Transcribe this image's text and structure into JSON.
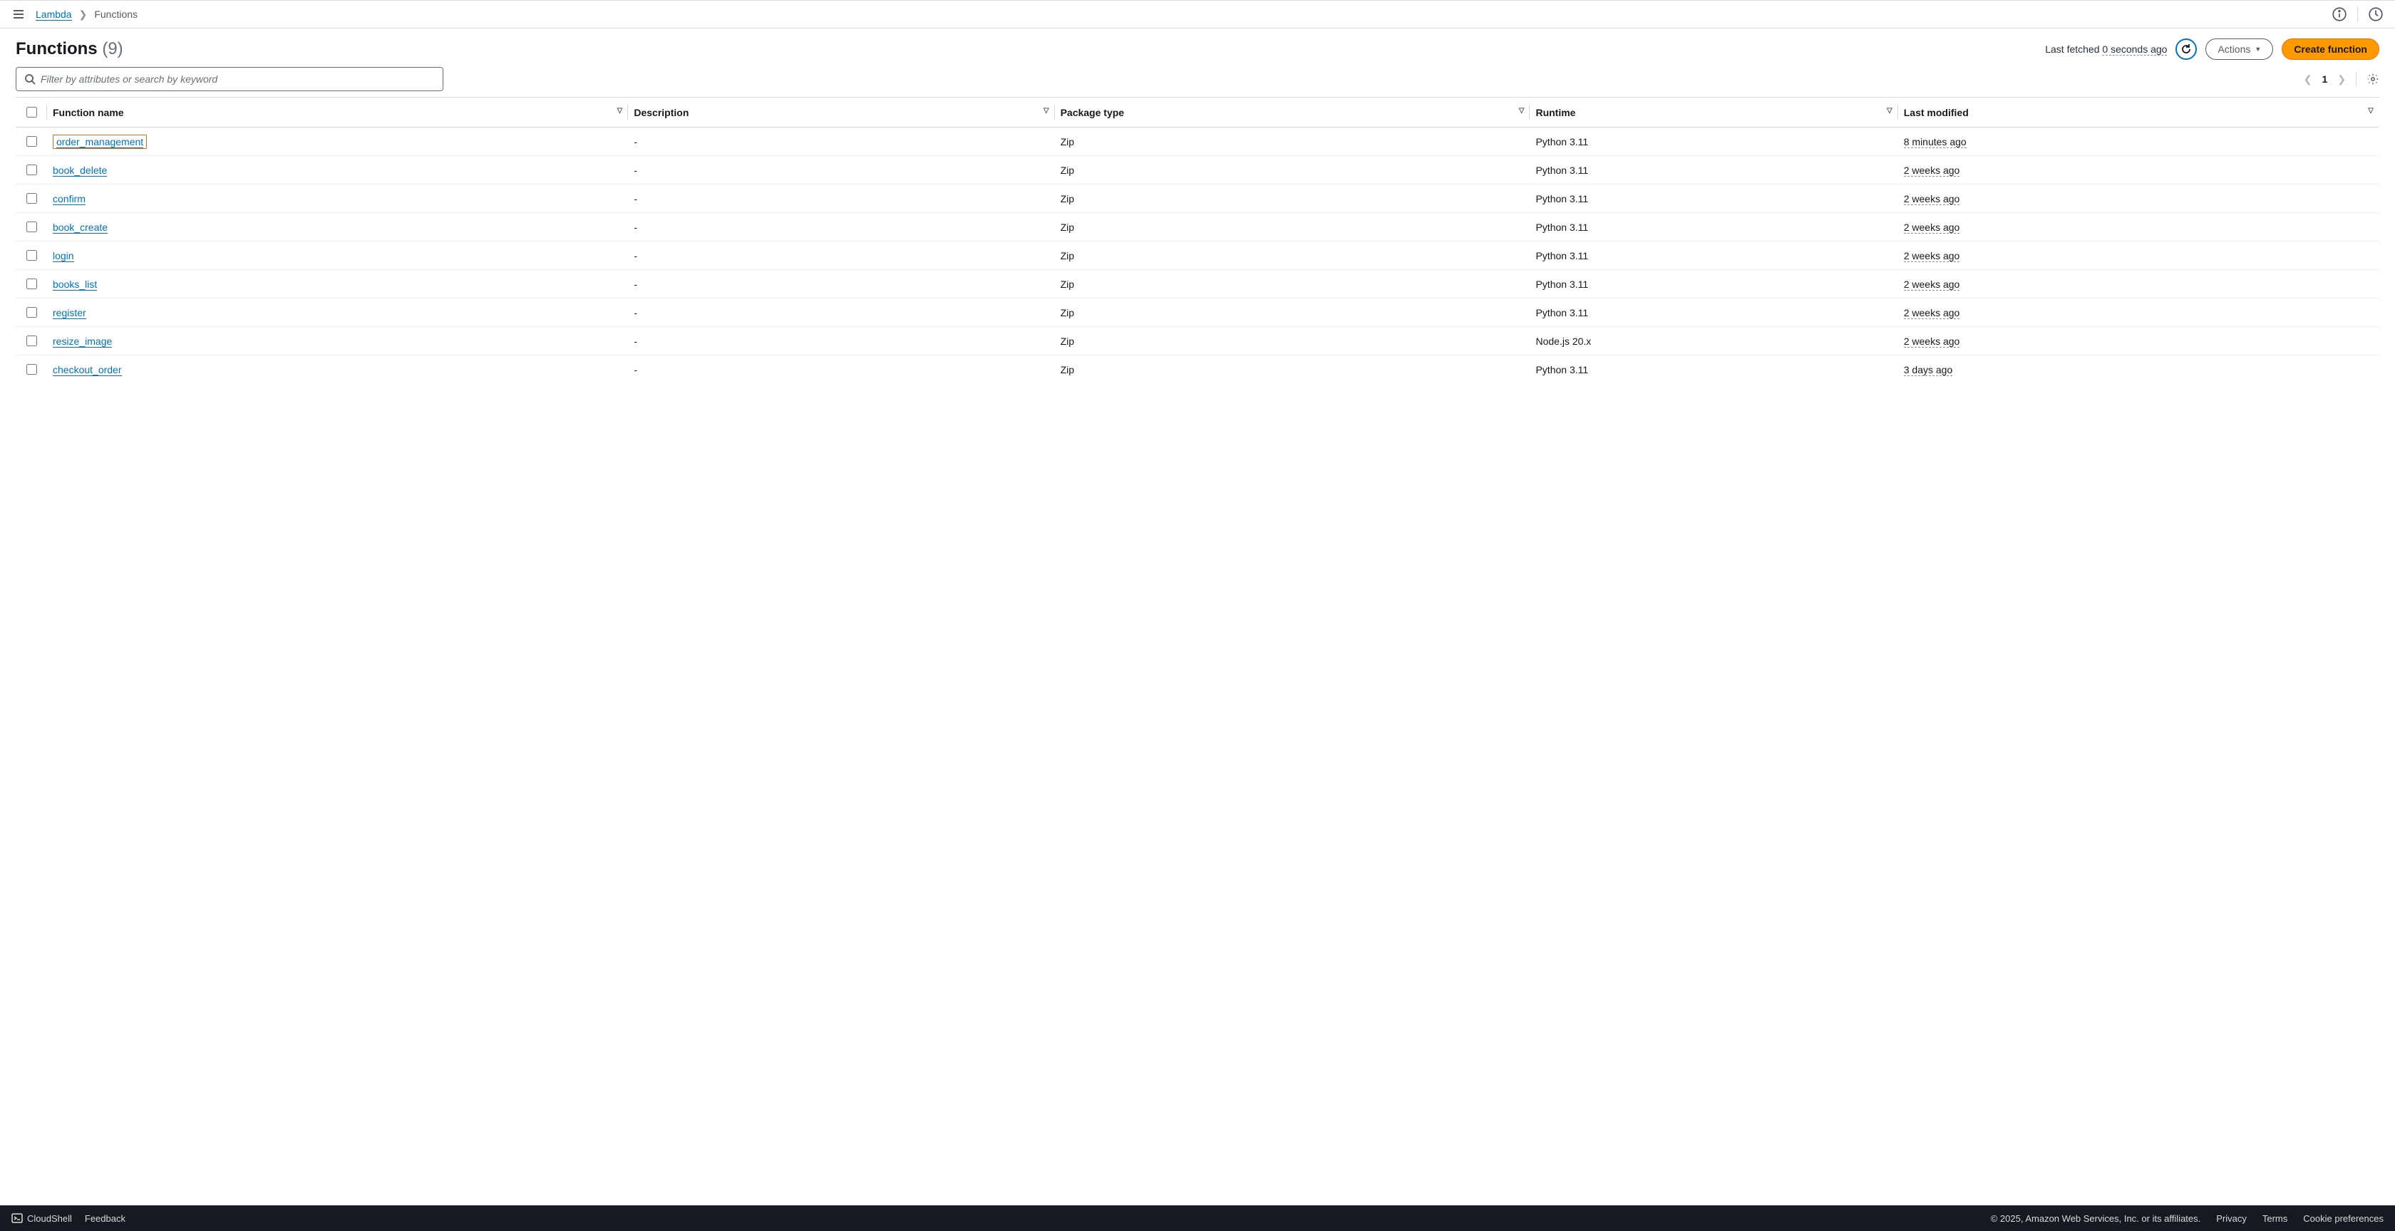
{
  "breadcrumb": {
    "service": "Lambda",
    "current": "Functions"
  },
  "page": {
    "title": "Functions",
    "count": "(9)",
    "last_fetched_label": "Last fetched",
    "last_fetched_ago": "0 seconds ago",
    "actions_label": "Actions",
    "create_label": "Create function",
    "search_placeholder": "Filter by attributes or search by keyword",
    "page_number": "1"
  },
  "columns": {
    "name": "Function name",
    "description": "Description",
    "package": "Package type",
    "runtime": "Runtime",
    "modified": "Last modified"
  },
  "rows": [
    {
      "name": "order_management",
      "description": "-",
      "package": "Zip",
      "runtime": "Python 3.11",
      "modified": "8 minutes ago",
      "highlighted": true
    },
    {
      "name": "book_delete",
      "description": "-",
      "package": "Zip",
      "runtime": "Python 3.11",
      "modified": "2 weeks ago"
    },
    {
      "name": "confirm",
      "description": "-",
      "package": "Zip",
      "runtime": "Python 3.11",
      "modified": "2 weeks ago"
    },
    {
      "name": "book_create",
      "description": "-",
      "package": "Zip",
      "runtime": "Python 3.11",
      "modified": "2 weeks ago"
    },
    {
      "name": "login",
      "description": "-",
      "package": "Zip",
      "runtime": "Python 3.11",
      "modified": "2 weeks ago"
    },
    {
      "name": "books_list",
      "description": "-",
      "package": "Zip",
      "runtime": "Python 3.11",
      "modified": "2 weeks ago"
    },
    {
      "name": "register",
      "description": "-",
      "package": "Zip",
      "runtime": "Python 3.11",
      "modified": "2 weeks ago"
    },
    {
      "name": "resize_image",
      "description": "-",
      "package": "Zip",
      "runtime": "Node.js 20.x",
      "modified": "2 weeks ago"
    },
    {
      "name": "checkout_order",
      "description": "-",
      "package": "Zip",
      "runtime": "Python 3.11",
      "modified": "3 days ago"
    }
  ],
  "footer": {
    "cloudshell": "CloudShell",
    "feedback": "Feedback",
    "copyright": "© 2025, Amazon Web Services, Inc. or its affiliates.",
    "privacy": "Privacy",
    "terms": "Terms",
    "cookies": "Cookie preferences"
  }
}
